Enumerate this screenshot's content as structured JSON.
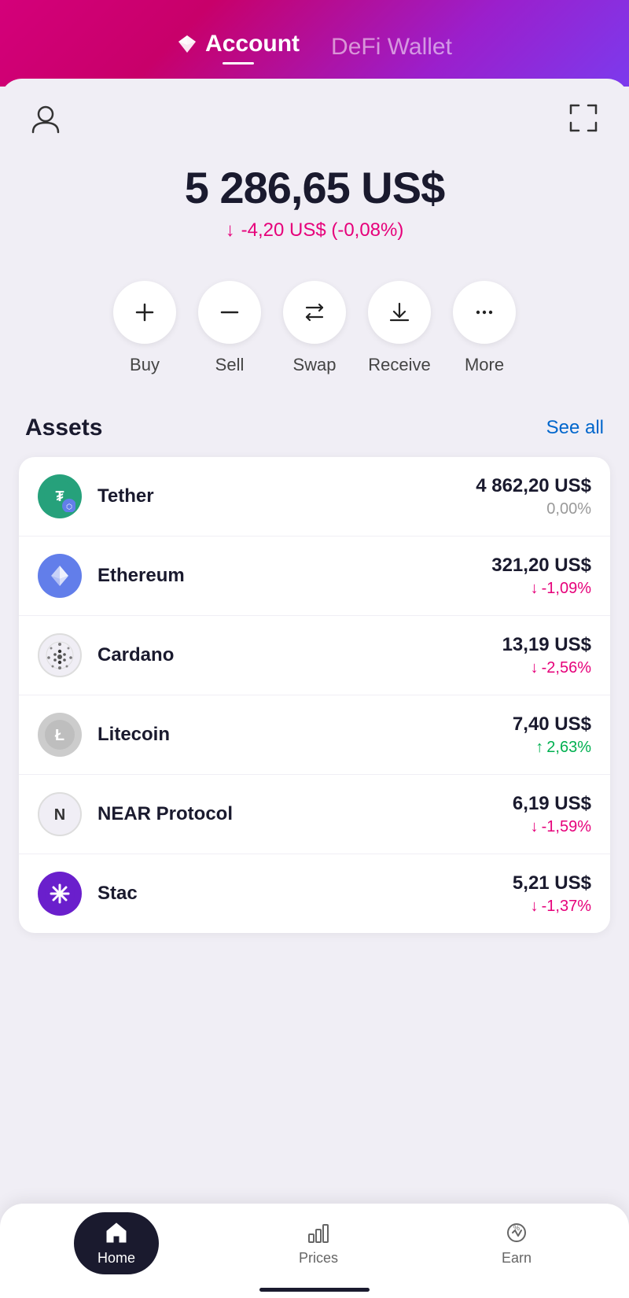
{
  "header": {
    "active_tab": "Account",
    "inactive_tab": "DeFi Wallet"
  },
  "balance": {
    "amount": "5 286,65 US$",
    "change": "-4,20 US$  (-0,08%)"
  },
  "actions": [
    {
      "id": "buy",
      "label": "Buy",
      "icon": "plus"
    },
    {
      "id": "sell",
      "label": "Sell",
      "icon": "minus"
    },
    {
      "id": "swap",
      "label": "Swap",
      "icon": "swap"
    },
    {
      "id": "receive",
      "label": "Receive",
      "icon": "download"
    },
    {
      "id": "more",
      "label": "More",
      "icon": "dots"
    }
  ],
  "assets_section": {
    "title": "Assets",
    "see_all": "See all"
  },
  "assets": [
    {
      "name": "Tether",
      "value": "4 862,20 US$",
      "change": "0,00%",
      "direction": "neutral"
    },
    {
      "name": "Ethereum",
      "value": "321,20 US$",
      "change": "-1,09%",
      "direction": "negative"
    },
    {
      "name": "Cardano",
      "value": "13,19 US$",
      "change": "-2,56%",
      "direction": "negative"
    },
    {
      "name": "Litecoin",
      "value": "7,40 US$",
      "change": "2,63%",
      "direction": "positive"
    },
    {
      "name": "NEAR Protocol",
      "value": "6,19 US$",
      "change": "-1,59%",
      "direction": "negative"
    },
    {
      "name": "Stac",
      "value": "5,21 US$",
      "change": "-1,37%",
      "direction": "negative"
    }
  ],
  "nav": {
    "items": [
      {
        "id": "home",
        "label": "Home",
        "active": true
      },
      {
        "id": "prices",
        "label": "Prices",
        "active": false
      },
      {
        "id": "earn",
        "label": "Earn",
        "active": false
      }
    ]
  }
}
